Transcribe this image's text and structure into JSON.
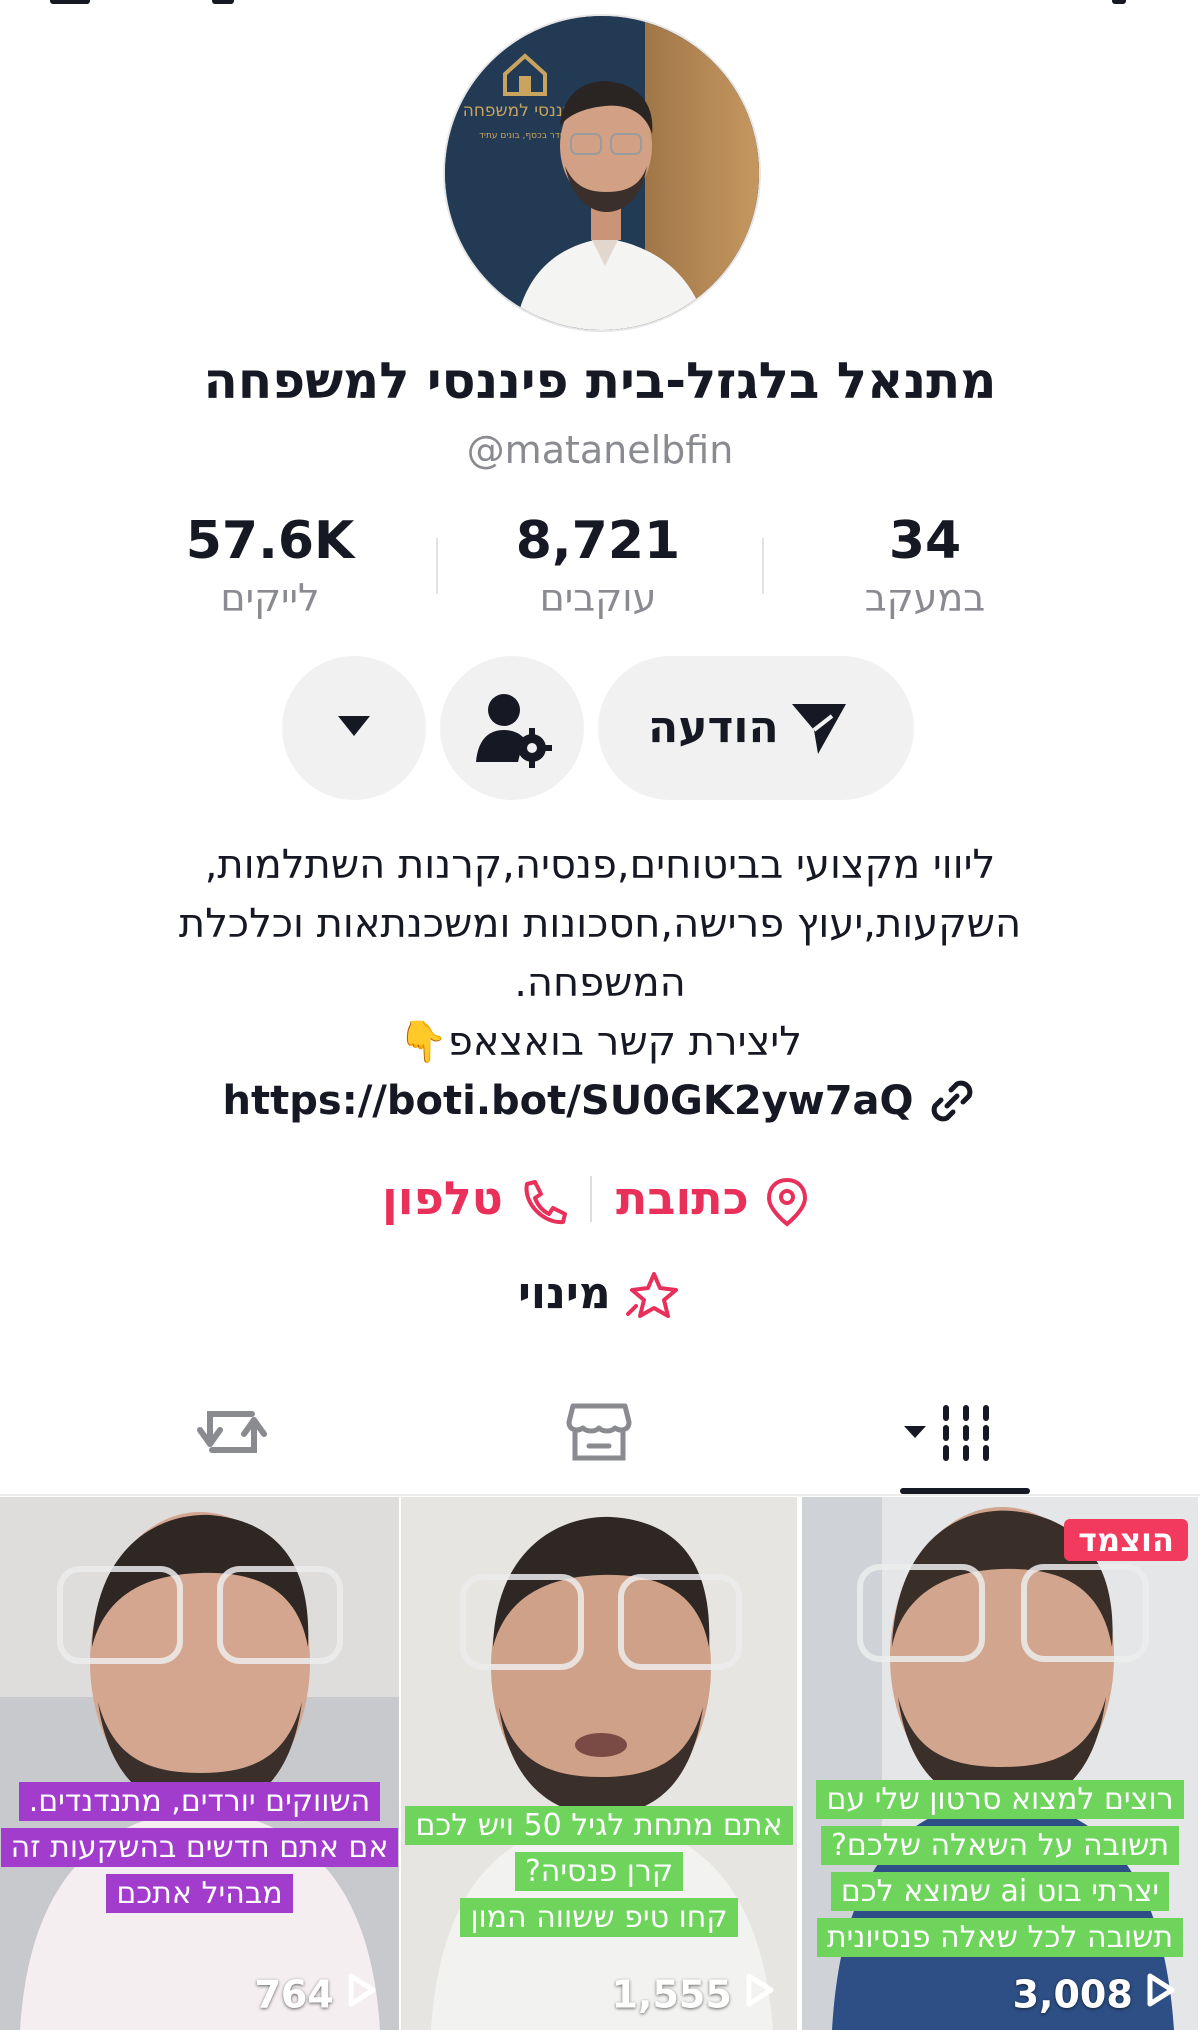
{
  "profile": {
    "name": "מתנאל בלגזל-בית פיננסי למשפחה",
    "handle": "@matanelbfin",
    "avatar_logo_text": "בית פיננסי למשפחה",
    "avatar_tagline": "עושים סדר בכסף, בונים עתיד"
  },
  "stats": {
    "following": {
      "value": "34",
      "label": "במעקב"
    },
    "followers": {
      "value": "8,721",
      "label": "עוקבים"
    },
    "likes": {
      "value": "57.6K",
      "label": "לייקים"
    }
  },
  "buttons": {
    "message_label": "הודעה",
    "message_icon": "send-icon",
    "user_icon": "user-settings-icon",
    "more_icon": "caret-down-icon"
  },
  "bio": {
    "lines": [
      "ליווי מקצועי בביטוחים,פנסיה,קרנות השתלמות,",
      "השקעות,יעוץ פרישה,חסכונות ומשכנתאות וכלכלת",
      "המשפחה.",
      "ליצירת קשר בואצאפ👇"
    ],
    "link": "https://boti.bot/SU0GK2yw7aQ"
  },
  "contact": {
    "address_label": "כתובת",
    "phone_label": "טלפון"
  },
  "minui_label": "מינוי",
  "tabs": [
    {
      "name": "videos",
      "icon": "grid-icon",
      "active": true
    },
    {
      "name": "shop",
      "icon": "store-icon",
      "active": false
    },
    {
      "name": "reposts",
      "icon": "repost-icon",
      "active": false
    }
  ],
  "videos": [
    {
      "caption": [
        "רוצים למצוא סרטון שלי עם",
        "תשובה על השאלה שלכם?",
        "יצרתי בוט ai שמוצא לכם",
        "תשובה לכל שאלה פנסיונית"
      ],
      "views": "3,008",
      "pinned_label": "הוצמד",
      "caption_color": "#6fd45c"
    },
    {
      "caption": [
        "אתם מתחת לגיל 50 ויש לכם",
        "קרן פנסיה?",
        "קחו טיפ ששווה המון"
      ],
      "views": "1,555",
      "caption_color": "#6fd45c"
    },
    {
      "caption": [
        "השווקים יורדים, מתנדנדים.",
        "אם אתם חדשים בהשקעות זה",
        "מבהיל אתכם"
      ],
      "views": "764",
      "caption_color": "#a23ccc"
    }
  ],
  "colors": {
    "accent": "#e8305a",
    "text": "#161823",
    "muted": "#8a8b91",
    "button_bg": "#f1f1f2"
  }
}
